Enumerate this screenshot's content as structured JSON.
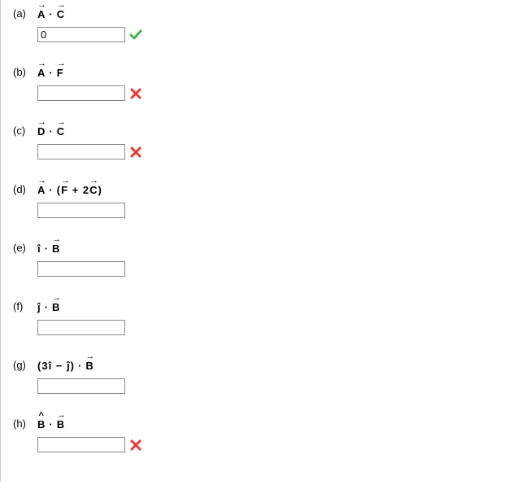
{
  "parts": [
    {
      "letter": "(a)",
      "vec1": "A",
      "vec1_type": "vec",
      "op": "dot",
      "vec2": "C",
      "vec2_type": "vec",
      "value": "0",
      "status": "correct"
    },
    {
      "letter": "(b)",
      "vec1": "A",
      "vec1_type": "vec",
      "op": "dot",
      "vec2": "F",
      "vec2_type": "vec",
      "value": "",
      "status": "incorrect"
    },
    {
      "letter": "(c)",
      "vec1": "D",
      "vec1_type": "vec",
      "op": "dot",
      "vec2": "C",
      "vec2_type": "vec",
      "value": "",
      "status": "incorrect"
    },
    {
      "letter": "(d)",
      "custom": true,
      "value": "",
      "status": "none"
    },
    {
      "letter": "(e)",
      "vec1": "î",
      "vec1_type": "plain",
      "op": "dot",
      "vec2": "B",
      "vec2_type": "vec",
      "value": "",
      "status": "none"
    },
    {
      "letter": "(f)",
      "vec1": "ĵ",
      "vec1_type": "plain",
      "op": "dot",
      "vec2": "B",
      "vec2_type": "vec",
      "value": "",
      "status": "none"
    },
    {
      "letter": "(g)",
      "custom_g": true,
      "value": "",
      "status": "none"
    },
    {
      "letter": "(h)",
      "vec1": "B",
      "vec1_type": "hat",
      "op": "dot",
      "vec2": "B",
      "vec2_type": "vec",
      "value": "",
      "status": "incorrect"
    }
  ],
  "custom_d": {
    "v1": "A",
    "v2": "F",
    "plus": " + 2",
    "v3": "C"
  },
  "custom_g": {
    "open": "(3",
    "i": "î",
    "minus": " − ",
    "j": "ĵ",
    "close": ")",
    "v": "B"
  }
}
